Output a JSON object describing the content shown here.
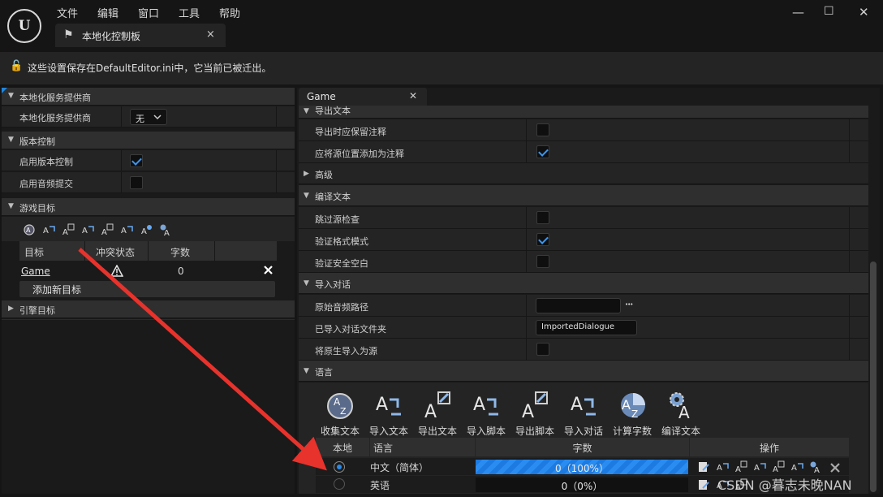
{
  "menu": [
    "文件",
    "编辑",
    "窗口",
    "工具",
    "帮助"
  ],
  "tab": {
    "title": "本地化控制板",
    "close": "×"
  },
  "window_controls": {
    "minimize": "—",
    "maximize": "☐",
    "close": "✕"
  },
  "notice": "这些设置保存在DefaultEditor.ini中，它当前已被迁出。",
  "left": {
    "provider_section": "本地化服务提供商",
    "provider_label": "本地化服务提供商",
    "provider_value": "无",
    "version_section": "版本控制",
    "enable_version": "启用版本控制",
    "enable_version_checked": true,
    "enable_audio": "启用音频提交",
    "enable_audio_checked": false,
    "game_targets_section": "游戏目标",
    "table_headers": [
      "目标",
      "冲突状态",
      "字数"
    ],
    "target_name": "Game",
    "target_words": "0",
    "add_target": "添加新目标",
    "engine_targets_section": "引擎目标"
  },
  "right": {
    "tab": "Game",
    "export_section": "导出文本",
    "keep_comments": "导出时应保留注释",
    "keep_comments_checked": false,
    "add_source_location": "应将源位置添加为注释",
    "add_source_location_checked": true,
    "advanced": "高级",
    "compile_section": "编译文本",
    "skip_source_check": "跳过源检查",
    "skip_source_check_checked": false,
    "validate_format": "验证格式模式",
    "validate_format_checked": true,
    "validate_whitespace": "验证安全空白",
    "validate_whitespace_checked": false,
    "import_dialogue_section": "导入对话",
    "raw_audio_path": "原始音频路径",
    "raw_audio_path_value": "",
    "ellipsis": "•••",
    "imported_dialogue_folder": "已导入对话文件夹",
    "imported_dialogue_folder_value": "ImportedDialogue",
    "import_native_as_source": "将原生导入为源",
    "import_native_checked": false,
    "language_section": "语言",
    "tools": [
      "收集文本",
      "导入文本",
      "导出文本",
      "导入脚本",
      "导出脚本",
      "导入对话",
      "计算字数",
      "编译文本"
    ],
    "lang_headers": [
      "本地",
      "语言",
      "字数",
      "操作"
    ],
    "languages": [
      {
        "name": "中文（简体）",
        "words": "0（100%）",
        "progress": 1.0,
        "selected": true
      },
      {
        "name": "英语",
        "words": "0（0%）",
        "progress": 0.0,
        "selected": false
      }
    ],
    "watermark": "CSDN @暮志未晚NAN"
  },
  "colors": {
    "accent": "#2b8ae8",
    "arrow": "#e8322c"
  }
}
